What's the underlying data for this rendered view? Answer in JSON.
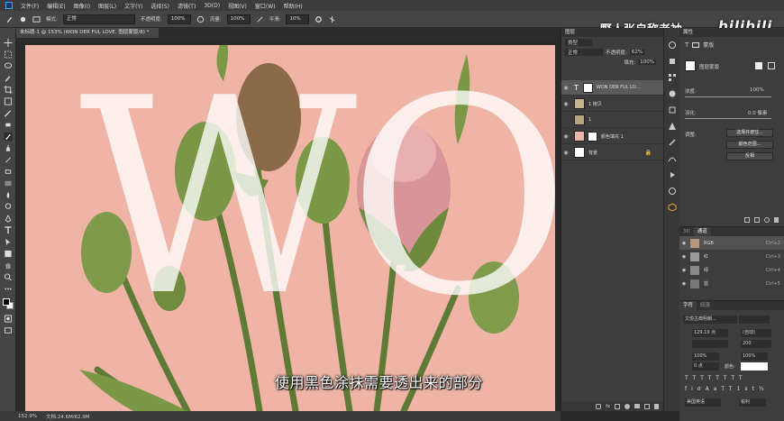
{
  "menu": [
    "文件(F)",
    "编辑(E)",
    "图像(I)",
    "图层(L)",
    "文字(Y)",
    "选择(S)",
    "滤镜(T)",
    "3D(D)",
    "视图(V)",
    "窗口(W)",
    "帮助(H)"
  ],
  "options": {
    "mode_label": "模式:",
    "mode_value": "正常",
    "opacity_label": "不透明度:",
    "opacity_value": "100%",
    "flow_label": "流量:",
    "flow_value": "100%",
    "smooth_label": "平滑:",
    "smooth_value": "10%"
  },
  "document_tab": "未标题-1 @ 153% (WON DER FUL LOVE, 图层蒙版/8) *",
  "status": {
    "zoom": "152.9%",
    "doc": "文档:24.6M/62.9M"
  },
  "subtitle": "使用黑色涂抹需要透出来的部分",
  "canvas_text": "WO",
  "watermark": {
    "name": "野人张自称老衲",
    "logo": "bilibili"
  },
  "layers_panel": {
    "tab": "图层",
    "kind": "类型",
    "blend": "正常",
    "opacity_label": "不透明度:",
    "opacity": "62%",
    "fill_label": "填充:",
    "fill": "100%",
    "layers": [
      {
        "name": "WON DER FUL LO...",
        "thumb": "#ffffff",
        "selected": true
      },
      {
        "name": "1 拷贝",
        "thumb": "#c9b48f",
        "selected": false
      },
      {
        "name": "1",
        "thumb": "#b9a67f",
        "selected": false
      },
      {
        "name": "颜色填充 1",
        "thumb": "#efb4a6",
        "selected": false
      },
      {
        "name": "背景",
        "thumb": "#ffffff",
        "selected": false
      }
    ]
  },
  "properties": {
    "tab": "属性",
    "title": "蒙版",
    "mask_label": "图层蒙版",
    "density_label": "浓度:",
    "density": "100%",
    "feather_label": "羽化:",
    "feather": "0.0 像素",
    "adjust_label": "调整:",
    "btn1": "选择并遮住...",
    "btn2": "颜色范围...",
    "btn3": "反相"
  },
  "channels": {
    "tab1": "3D",
    "tab2": "通道",
    "rows": [
      {
        "name": "RGB",
        "shortcut": "Ctrl+2"
      },
      {
        "name": "红",
        "shortcut": "Ctrl+3"
      },
      {
        "name": "绿",
        "shortcut": "Ctrl+4"
      },
      {
        "name": "蓝",
        "shortcut": "Ctrl+5"
      }
    ]
  },
  "character": {
    "tab1": "字符",
    "tab2": "段落",
    "font": "文悦古典明朝...",
    "size": "129.19 点",
    "leading": "(自动)",
    "tracking": "200",
    "vscale": "100%",
    "hscale": "100%",
    "baseline": "0 点",
    "color_label": "颜色:",
    "lang": "美国英语",
    "aa": "锐利"
  }
}
